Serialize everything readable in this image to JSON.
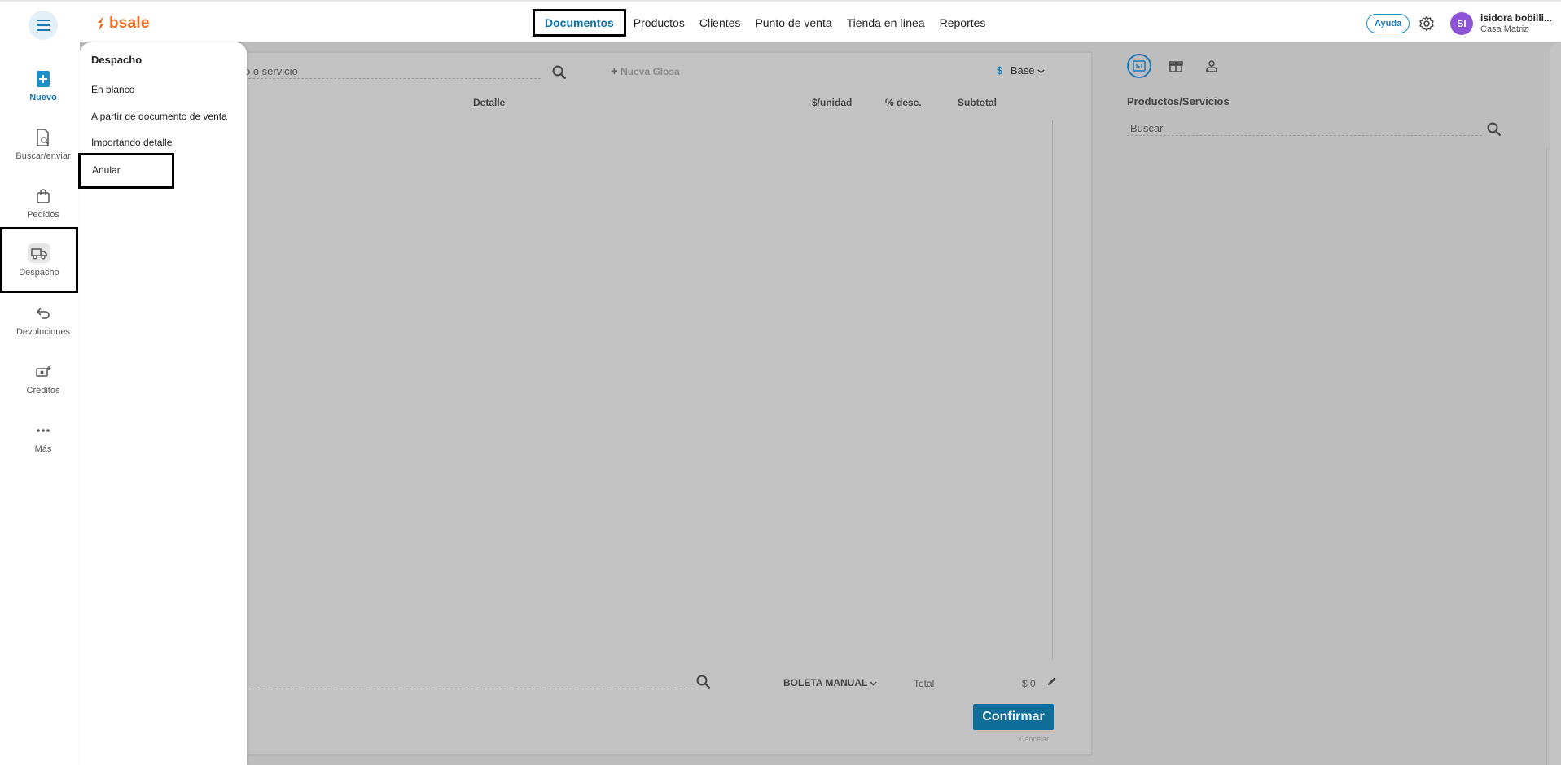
{
  "header": {
    "logo_text": "bsale",
    "nav": [
      "Documentos",
      "Productos",
      "Clientes",
      "Punto de venta",
      "Tienda en línea",
      "Reportes"
    ],
    "help_label": "Ayuda",
    "avatar_initials": "SI",
    "user_name": "isidora bobilli...",
    "user_branch": "Casa Matriz"
  },
  "sidebar": {
    "items": [
      {
        "label": "Nuevo",
        "icon": "new-document-icon"
      },
      {
        "label": "Buscar/enviar",
        "icon": "search-document-icon"
      },
      {
        "label": "Pedidos",
        "icon": "bag-icon"
      },
      {
        "label": "Despacho",
        "icon": "truck-icon"
      },
      {
        "label": "Devoluciones",
        "icon": "return-icon"
      },
      {
        "label": "Créditos",
        "icon": "credit-icon"
      },
      {
        "label": "Más",
        "icon": "more-icon"
      }
    ]
  },
  "menu": {
    "title": "Despacho",
    "items": [
      "En blanco",
      "A partir de documento de venta",
      "Importando detalle",
      "Anular"
    ]
  },
  "document": {
    "search_placeholder": "o o servicio",
    "nueva_glosa": "Nueva Glosa",
    "currency_symbol": "$",
    "currency_label": "Base",
    "columns": [
      "Detalle",
      "$/unidad",
      "% desc.",
      "Subtotal"
    ],
    "doc_type": "BOLETA MANUAL",
    "total_label": "Total",
    "total_value": "$ 0",
    "confirm_label": "Confirmar",
    "cancel_label": "Cancelar"
  },
  "right_panel": {
    "title": "Productos/Servicios",
    "search_placeholder": "Buscar"
  },
  "colors": {
    "accent": "#1a7ab8",
    "brand": "#f26b21",
    "confirm": "#0f6d98",
    "avatar": "#8d53d6",
    "overlay": "#bdbdbd"
  }
}
